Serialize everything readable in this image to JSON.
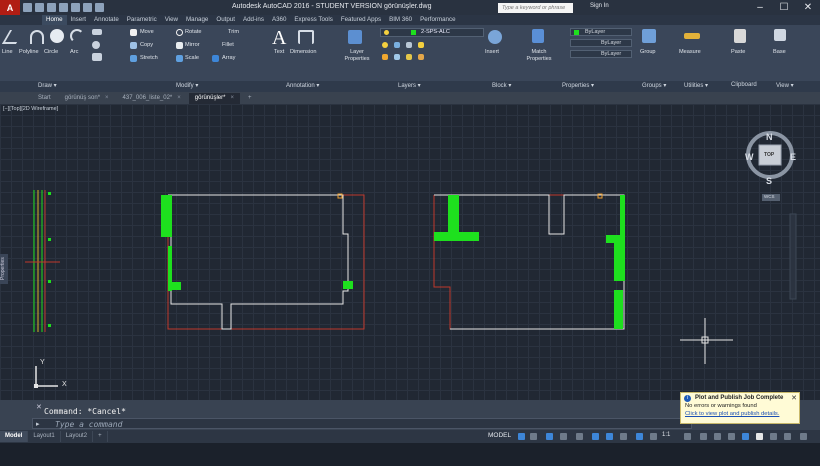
{
  "titlebar": {
    "app_button": "A",
    "title": "Autodesk AutoCAD 2016 - STUDENT VERSION    görünüşler.dwg",
    "search_placeholder": "Type a keyword or phrase",
    "sign_in": "Sign In",
    "minimize": "–",
    "maximize": "☐",
    "close": "✕"
  },
  "ribbon_tabs": [
    "Home",
    "Insert",
    "Annotate",
    "Parametric",
    "View",
    "Manage",
    "Output",
    "Add-ins",
    "A360",
    "Express Tools",
    "Featured Apps",
    "BIM 360",
    "Performance"
  ],
  "ribbon": {
    "draw": [
      "Line",
      "Polyline",
      "Circle",
      "Arc"
    ],
    "modify": [
      "Move",
      "Rotate",
      "Trim",
      "Copy",
      "Mirror",
      "Fillet",
      "Stretch",
      "Scale",
      "Array"
    ],
    "annotation": [
      "Text",
      "Dimension"
    ],
    "layers": {
      "layer_properties": "Layer Properties",
      "current_layer": "2-SPS-ALC"
    },
    "block": "Insert",
    "properties": {
      "match": "Match Properties",
      "color": "ByLayer",
      "linetype": "ByLayer",
      "lineweight": "ByLayer"
    },
    "groups": "Group",
    "utilities": "Measure",
    "clipboard": "Paste",
    "view": "Base",
    "panel_names": [
      "Draw ▾",
      "Modify ▾",
      "Annotation ▾",
      "Layers ▾",
      "Block ▾",
      "Properties ▾",
      "Groups ▾",
      "Utilities ▾",
      "Clipboard",
      "View ▾"
    ]
  },
  "file_tabs": [
    {
      "label": "Start",
      "active": false
    },
    {
      "label": "görünüş son*",
      "active": false
    },
    {
      "label": "437_006_liste_02*",
      "active": false
    },
    {
      "label": "görünüşler*",
      "active": true
    }
  ],
  "viewport": {
    "label": "[−][Top][2D Wireframe]",
    "properties_tab": "Properties",
    "viewcube": {
      "n": "N",
      "s": "S",
      "e": "E",
      "w": "W",
      "top": "TOP",
      "wcs": "WCS"
    },
    "ucs": {
      "x": "X",
      "y": "Y"
    }
  },
  "command": {
    "history": "Command: *Cancel*",
    "placeholder": "Type a command"
  },
  "layout_tabs": [
    "Model",
    "Layout1",
    "Layout2",
    "+"
  ],
  "status": {
    "model": "MODEL",
    "scale": "1:1"
  },
  "notification": {
    "title": "Plot and Publish Job Complete",
    "line": "No errors or warnings found",
    "link": "Click to view plot and publish details."
  },
  "colors": {
    "accent_red": "#b11d14",
    "green_fill": "#1ee01e",
    "red_line": "#c0392b",
    "white_line": "#e6e6e6"
  }
}
